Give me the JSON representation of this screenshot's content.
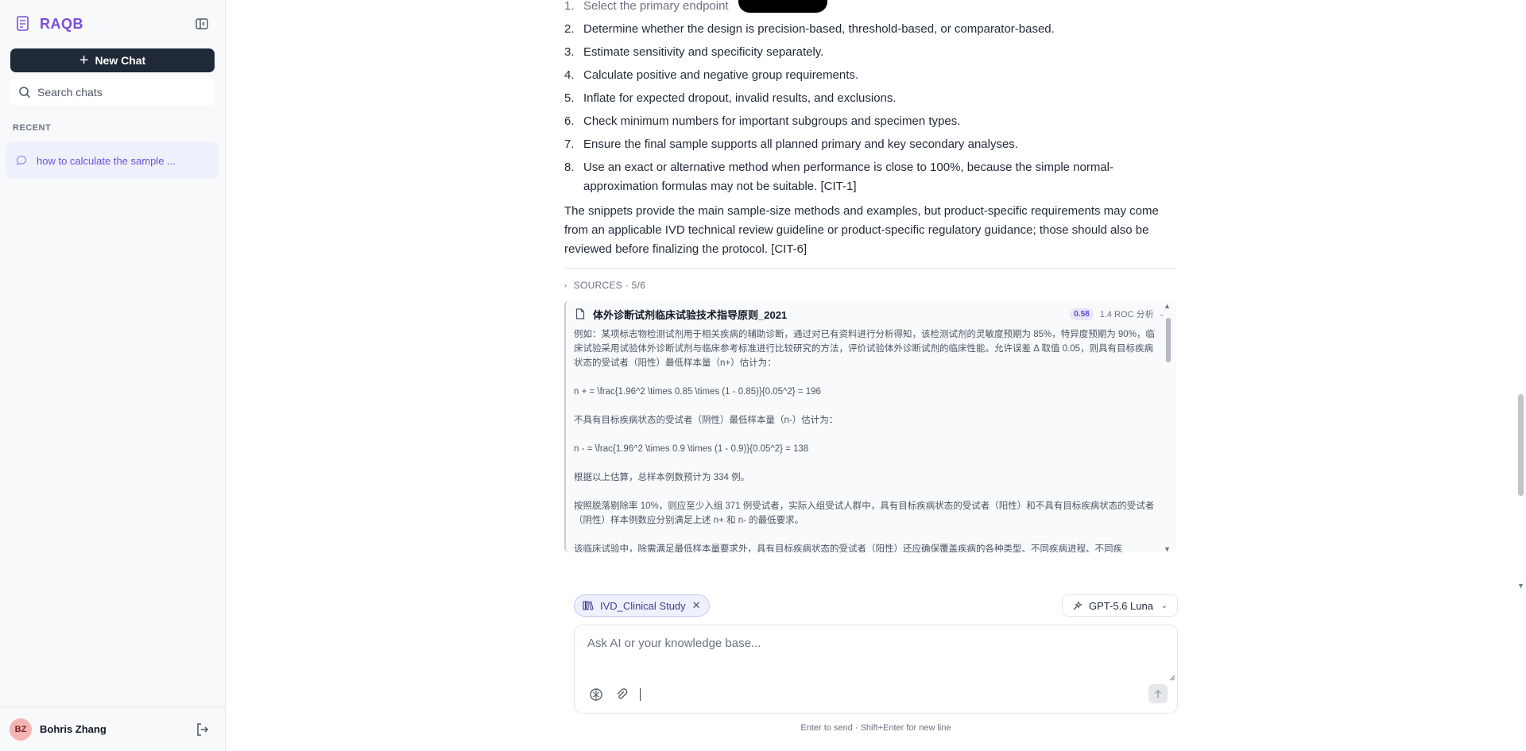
{
  "app": {
    "name": "RAQB"
  },
  "sidebar": {
    "new_chat_label": "New Chat",
    "search_placeholder": "Search chats",
    "recent_label": "RECENT",
    "chats": [
      {
        "title": "how to calculate the sample ..."
      }
    ],
    "user": {
      "initials": "BZ",
      "name": "Bohris Zhang"
    }
  },
  "message": {
    "steps": [
      {
        "num": "1.",
        "text": "Select the primary endpoint"
      },
      {
        "num": "2.",
        "text": "Determine whether the design is precision-based, threshold-based, or comparator-based."
      },
      {
        "num": "3.",
        "text": "Estimate sensitivity and specificity separately."
      },
      {
        "num": "4.",
        "text": "Calculate positive and negative group requirements."
      },
      {
        "num": "5.",
        "text": "Inflate for expected dropout, invalid results, and exclusions."
      },
      {
        "num": "6.",
        "text": "Check minimum numbers for important subgroups and specimen types."
      },
      {
        "num": "7.",
        "text": "Ensure the final sample supports all planned primary and key secondary analyses."
      },
      {
        "num": "8.",
        "text": "Use an exact or alternative method when performance is close to 100%, because the simple normal-approximation formulas may not be suitable. [CIT-1]"
      }
    ],
    "paragraph": "The snippets provide the main sample-size methods and examples, but product-specific requirements may come from an applicable IVD technical review guideline or product-specific regulatory guidance; those should also be reviewed before finalizing the protocol. [CIT-6]",
    "sources_label": "SOURCES · 5/6",
    "source": {
      "title": "体外诊断试剂临床试验技术指导原则_2021",
      "score": "0.58",
      "section": "1.4 ROC 分析",
      "paragraphs": [
        "例如：某项标志物检测试剂用于相关疾病的辅助诊断，通过对已有资料进行分析得知，该检测试剂的灵敏度预期为 85%，特异度预期为 90%，临床试验采用试验体外诊断试剂与临床参考标准进行比较研究的方法，评价试验体外诊断试剂的临床性能。允许误差 Δ 取值 0.05，则具有目标疾病状态的受试者（阳性）最低样本量（n+）估计为：",
        "n + = \\frac{1.96^2 \\times 0.85 \\times (1 - 0.85)}{0.05^2} = 196",
        "不具有目标疾病状态的受试者（阴性）最低样本量（n-）估计为：",
        "n - = \\frac{1.96^2 \\times 0.9 \\times (1 - 0.9)}{0.05^2} = 138",
        "根据以上估算，总样本例数预计为 334 例。",
        "按照脱落剔除率 10%，则应至少入组 371 例受试者，实际入组受试人群中，具有目标疾病状态的受试者（阳性）和不具有目标疾病状态的受试者（阴性）样本例数应分别满足上述 n+ 和 n- 的最低要求。",
        "该临床试验中，除需满足最低样本量要求外，具有目标疾病状态的受试者（阳性）还应确保覆盖疾病的各种类型、不同疾病进程、不同疾"
      ]
    }
  },
  "composer": {
    "kb_chip": "IVD_Clinical Study",
    "model": "GPT-5.6 Luna",
    "placeholder": "Ask AI or your knowledge base...",
    "hint": "Enter to send · Shift+Enter for new line"
  },
  "colors": {
    "brand": "#7c4ddb",
    "new_chat_bg": "#1f2937",
    "chip_bg": "#eef0fd"
  }
}
